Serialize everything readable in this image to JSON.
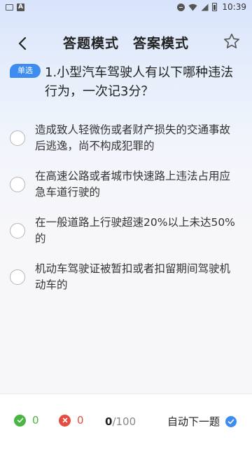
{
  "status_bar": {
    "time": "10:39",
    "icons": [
      "image-icon",
      "a-icon",
      "dnd-icon",
      "wifi-icon",
      "signal-icon",
      "battery-icon"
    ]
  },
  "header": {
    "tabs": [
      "答题模式",
      "答案模式"
    ],
    "back_icon": "back-arrow-icon",
    "favorite_icon": "star-outline-icon"
  },
  "question": {
    "type_badge": "单选",
    "text": "1.小型汽车驾驶人有以下哪种违法行为，一次记3分？"
  },
  "options": [
    {
      "text": "造成致人轻微伤或者财产损失的交通事故后逃逸，尚不构成犯罪的"
    },
    {
      "text": "在高速公路或者城市快速路上违法占用应急车道行驶的"
    },
    {
      "text": "在一般道路上行驶超速20%以上未达50%的"
    },
    {
      "text": "机动车驾驶证被暂扣或者扣留期间驾驶机动车的"
    }
  ],
  "bottom_bar": {
    "correct_count": "0",
    "wrong_count": "0",
    "progress_current": "0",
    "progress_total": "/100",
    "auto_next_label": "自动下一题",
    "auto_next_enabled": true
  },
  "colors": {
    "accent": "#3f8cf0",
    "correct": "#4bb543",
    "wrong": "#e54d42"
  }
}
